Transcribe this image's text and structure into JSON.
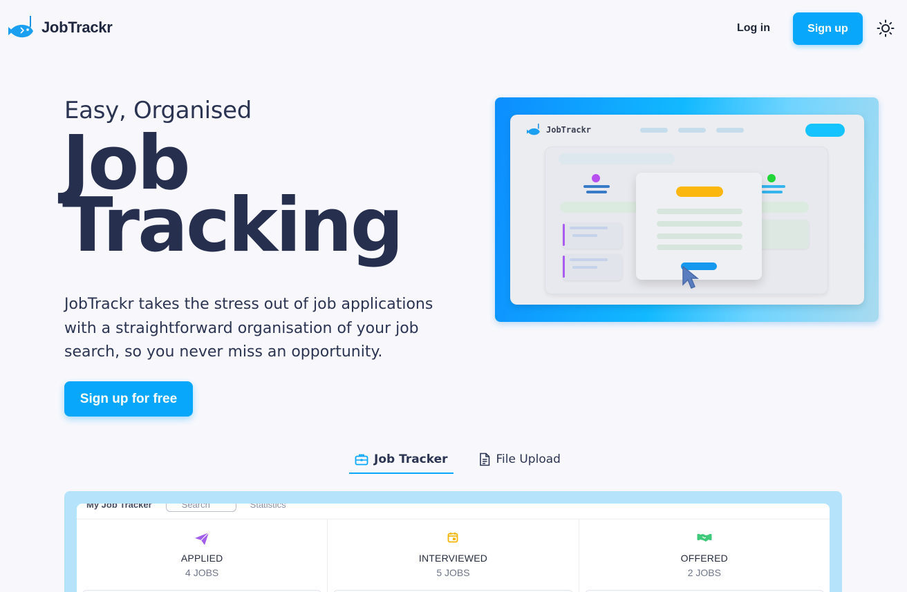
{
  "header": {
    "brand": "JobTrackr",
    "login_label": "Log in",
    "signup_label": "Sign up",
    "theme_icon": "sun-icon"
  },
  "hero": {
    "subtitle": "Easy, Organised",
    "title_line1": "Job",
    "title_line2": "Tracking",
    "description": "JobTrackr takes the stress out of job applications with a straightforward organisation of your job search, so you never miss an opportunity.",
    "cta_label": "Sign up for free"
  },
  "illustration": {
    "brand": "JobTrackr"
  },
  "tabs": [
    {
      "label": "Job Tracker",
      "icon": "briefcase-icon",
      "active": true
    },
    {
      "label": "File Upload",
      "icon": "document-icon",
      "active": false
    }
  ],
  "preview": {
    "title": "My Job Tracker",
    "search_placeholder": "Search",
    "stats_label": "Statistics",
    "columns": [
      {
        "title": "APPLIED",
        "count": "4 JOBS",
        "icon": "paper-plane-icon",
        "color": "#a25de9"
      },
      {
        "title": "INTERVIEWED",
        "count": "5 JOBS",
        "icon": "calendar-icon",
        "color": "#f4b400"
      },
      {
        "title": "OFFERED",
        "count": "2 JOBS",
        "icon": "handshake-icon",
        "color": "#3fc97a"
      }
    ]
  },
  "colors": {
    "accent": "#09a7fb",
    "text_dark": "#262f4d",
    "background": "#f8f8fc",
    "preview_border": "#b5e3fc"
  }
}
